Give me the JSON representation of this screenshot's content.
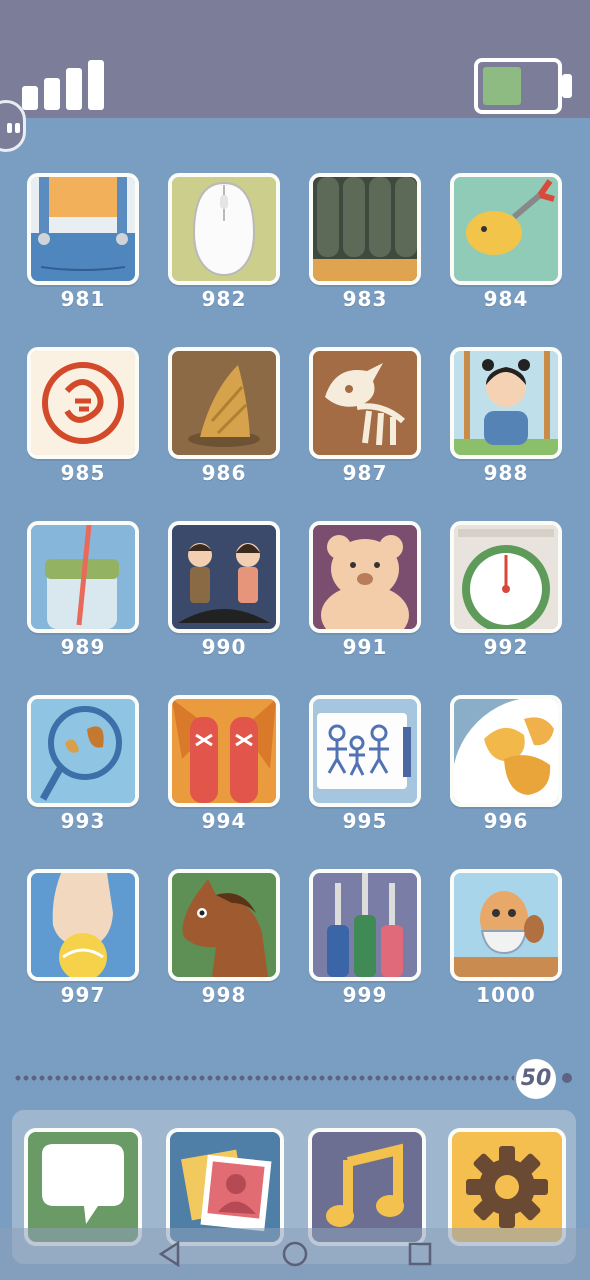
{
  "status": {
    "signal_icon": "signal-bars-icon",
    "battery_icon": "battery-icon",
    "battery_fill_color": "#8dbb82"
  },
  "levels": [
    {
      "number": "981",
      "icon": "overalls-icon"
    },
    {
      "number": "982",
      "icon": "computer-mouse-icon"
    },
    {
      "number": "983",
      "icon": "roof-tiles-icon"
    },
    {
      "number": "984",
      "icon": "pufferfish-grabber-icon"
    },
    {
      "number": "985",
      "icon": "red-seal-stamp-icon"
    },
    {
      "number": "986",
      "icon": "bamboo-shoot-icon"
    },
    {
      "number": "987",
      "icon": "triceratops-fossil-icon"
    },
    {
      "number": "988",
      "icon": "girl-on-swing-icon"
    },
    {
      "number": "989",
      "icon": "jar-with-straw-icon"
    },
    {
      "number": "990",
      "icon": "couple-magpie-bridge-icon"
    },
    {
      "number": "991",
      "icon": "teddy-bear-icon"
    },
    {
      "number": "992",
      "icon": "kitchen-scale-icon"
    },
    {
      "number": "993",
      "icon": "racket-leaves-icon"
    },
    {
      "number": "994",
      "icon": "sneakers-in-leaves-icon"
    },
    {
      "number": "995",
      "icon": "family-drawing-icon"
    },
    {
      "number": "996",
      "icon": "potato-chips-icon"
    },
    {
      "number": "997",
      "icon": "hand-with-lemon-icon"
    },
    {
      "number": "998",
      "icon": "horse-icon"
    },
    {
      "number": "999",
      "icon": "audio-plugs-icon"
    },
    {
      "number": "1000",
      "icon": "cat-with-bowl-icon"
    }
  ],
  "pager": {
    "current_page": "50"
  },
  "dock": [
    {
      "name": "messages",
      "icon": "chat-bubble-icon",
      "color": "#6a9a66"
    },
    {
      "name": "photos",
      "icon": "photos-icon",
      "color": "#4f7fa6"
    },
    {
      "name": "music",
      "icon": "music-note-icon",
      "color": "#6c6f92"
    },
    {
      "name": "settings",
      "icon": "gear-icon",
      "color": "#f5bf4f"
    }
  ],
  "navbar": {
    "back_icon": "back-triangle-icon",
    "home_icon": "home-circle-icon",
    "recents_icon": "recents-square-icon"
  }
}
